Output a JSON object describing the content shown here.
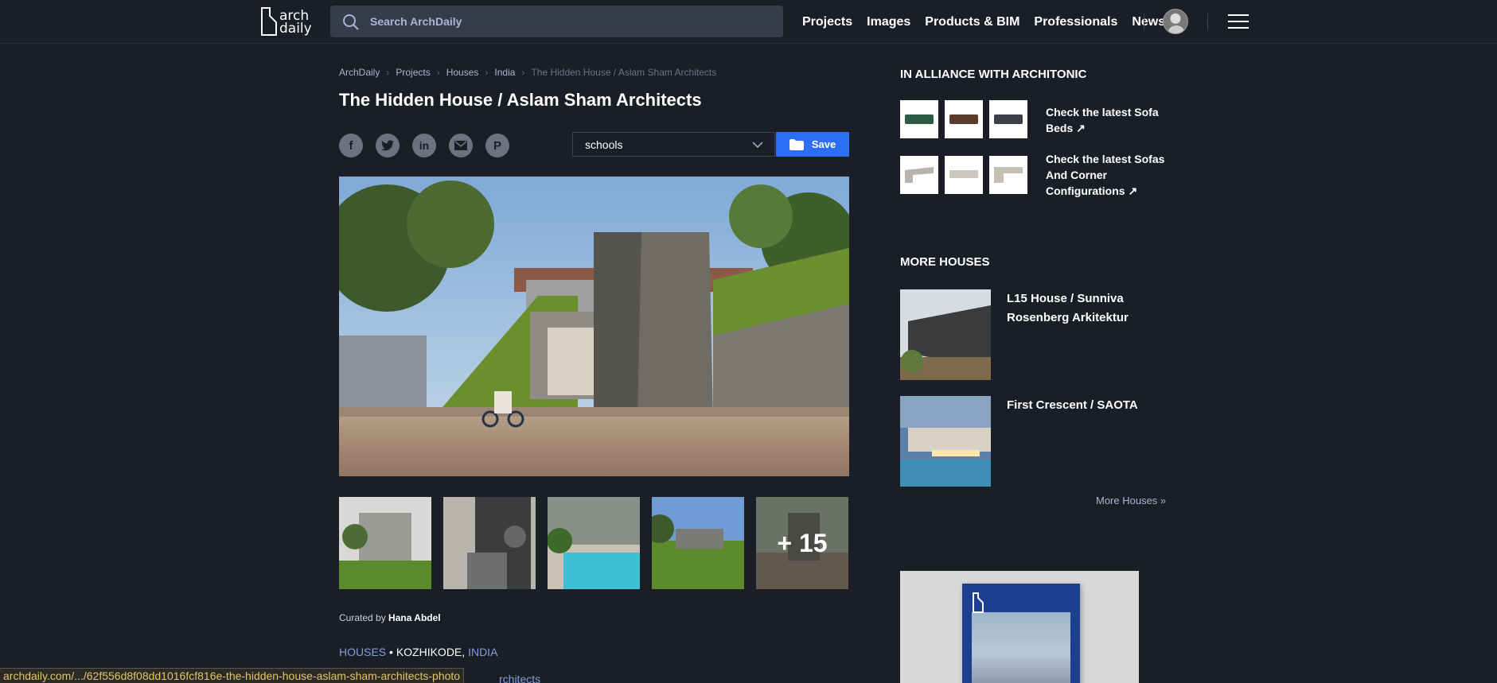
{
  "header": {
    "logo_text": "arch daily",
    "search_placeholder": "Search ArchDaily",
    "nav": [
      "Projects",
      "Images",
      "Products & BIM",
      "Professionals",
      "News"
    ]
  },
  "breadcrumb": [
    "ArchDaily",
    "Projects",
    "Houses",
    "India",
    "The Hidden House / Aslam Sham Architects"
  ],
  "article": {
    "title": "The Hidden House / Aslam Sham Architects",
    "folder_selected": "schools",
    "save_label": "Save",
    "thumbs_more": "+ 15",
    "curated_prefix": "Curated by",
    "curated_name": "Hana Abdel",
    "tag_category": "HOUSES",
    "tag_city": "KOZHIKODE",
    "tag_country": "INDIA",
    "cutoff_text": "rchitects"
  },
  "share_icons": [
    "facebook-icon",
    "twitter-icon",
    "linkedin-icon",
    "email-icon",
    "pinterest-icon"
  ],
  "sidebar": {
    "alliance_title": "IN ALLIANCE WITH ARCHITONIC",
    "product_link_1": "Check the latest Sofa Beds",
    "product_link_2": "Check the latest Sofas And Corner Configurations",
    "more_title": "MORE HOUSES",
    "houses": [
      {
        "title": "L15 House / Sunniva Rosenberg Arkitektur"
      },
      {
        "title": "First Crescent / SAOTA"
      }
    ],
    "more_link": "More Houses »"
  },
  "status_bar": {
    "url": "archdaily.com/.../62f556d8f08dd1016fcf816e-the-hidden-house-aslam-sham-architects-photo"
  }
}
